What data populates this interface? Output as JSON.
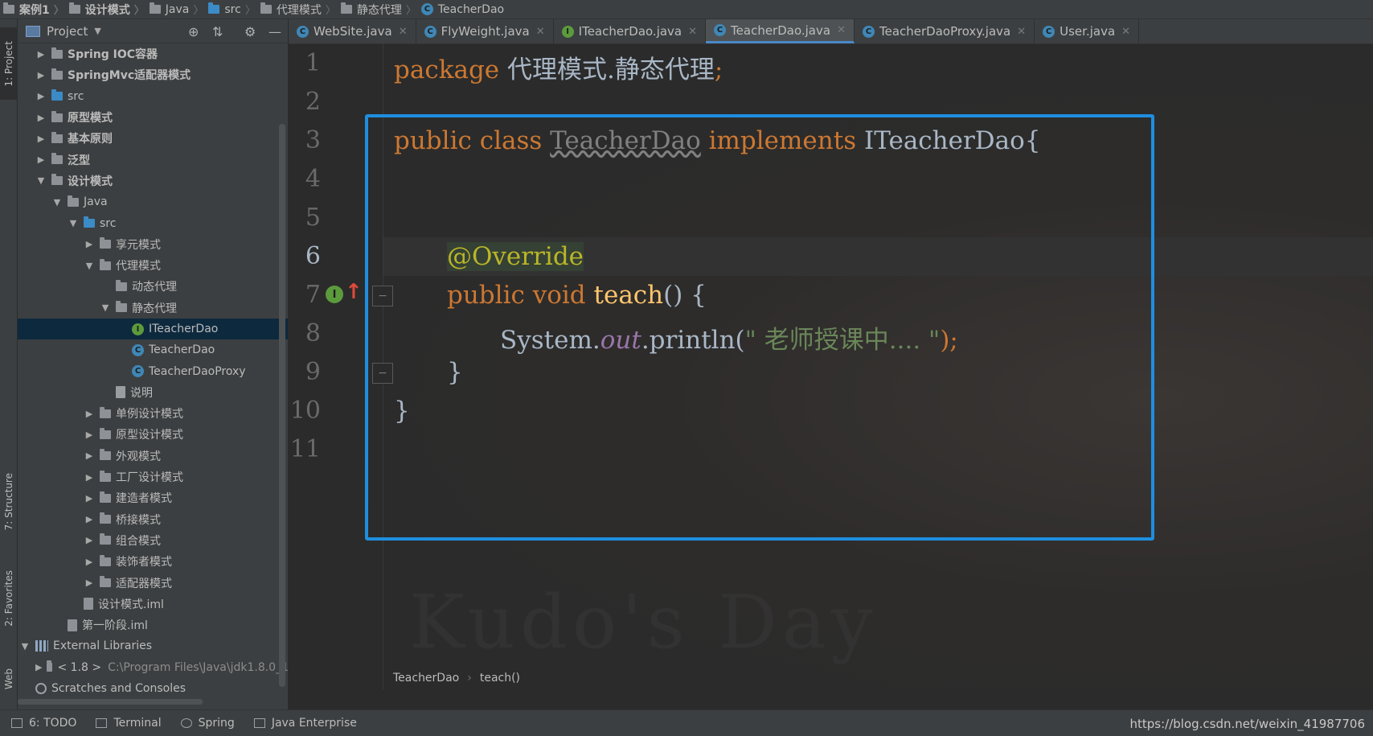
{
  "breadcrumb": [
    "案例1",
    "设计模式",
    "Java",
    "src",
    "代理模式",
    "静态代理",
    "TeacherDao"
  ],
  "side_tabs": {
    "project": "1: Project",
    "structure": "7: Structure",
    "favorites": "2: Favorites",
    "web": "Web"
  },
  "project_panel": {
    "title": "Project"
  },
  "tree": [
    {
      "label": "Spring IOC容器",
      "icon": "module-folder",
      "expand": "collapsed",
      "bold": true
    },
    {
      "label": "SpringMvc适配器模式",
      "icon": "module-folder",
      "expand": "collapsed",
      "bold": true
    },
    {
      "label": "src",
      "icon": "source-folder",
      "expand": "collapsed",
      "bold": false
    },
    {
      "label": "原型模式",
      "icon": "module-folder",
      "expand": "collapsed",
      "bold": true
    },
    {
      "label": "基本原则",
      "icon": "module-folder",
      "expand": "collapsed",
      "bold": true
    },
    {
      "label": "泛型",
      "icon": "module-folder",
      "expand": "collapsed",
      "bold": true
    },
    {
      "label": "设计模式",
      "icon": "module-folder",
      "expand": "expanded",
      "bold": true
    },
    {
      "label": "Java",
      "icon": "folder",
      "expand": "expanded",
      "bold": false
    },
    {
      "label": "src",
      "icon": "source-folder",
      "expand": "expanded",
      "bold": false
    },
    {
      "label": "享元模式",
      "icon": "package",
      "expand": "collapsed",
      "bold": false
    },
    {
      "label": "代理模式",
      "icon": "package",
      "expand": "expanded",
      "bold": false
    },
    {
      "label": "动态代理",
      "icon": "package",
      "expand": "none",
      "bold": false
    },
    {
      "label": "静态代理",
      "icon": "package",
      "expand": "expanded",
      "bold": false
    },
    {
      "label": "ITeacherDao",
      "icon": "interface",
      "expand": "none",
      "bold": false,
      "selected": true
    },
    {
      "label": "TeacherDao",
      "icon": "class",
      "expand": "none",
      "bold": false
    },
    {
      "label": "TeacherDaoProxy",
      "icon": "class",
      "expand": "none",
      "bold": false
    },
    {
      "label": "说明",
      "icon": "text-file",
      "expand": "none",
      "bold": false
    },
    {
      "label": "单例设计模式",
      "icon": "package",
      "expand": "collapsed",
      "bold": false
    },
    {
      "label": "原型设计模式",
      "icon": "package",
      "expand": "collapsed",
      "bold": false
    },
    {
      "label": "外观模式",
      "icon": "package",
      "expand": "collapsed",
      "bold": false
    },
    {
      "label": "工厂设计模式",
      "icon": "package",
      "expand": "collapsed",
      "bold": false
    },
    {
      "label": "建造者模式",
      "icon": "package",
      "expand": "collapsed",
      "bold": false
    },
    {
      "label": "桥接模式",
      "icon": "package",
      "expand": "collapsed",
      "bold": false
    },
    {
      "label": "组合模式",
      "icon": "package",
      "expand": "collapsed",
      "bold": false
    },
    {
      "label": "装饰者模式",
      "icon": "package",
      "expand": "collapsed",
      "bold": false
    },
    {
      "label": "适配器模式",
      "icon": "package",
      "expand": "collapsed",
      "bold": false
    },
    {
      "label": "设计模式.iml",
      "icon": "iml-file",
      "expand": "none",
      "bold": false
    },
    {
      "label": "第一阶段.iml",
      "icon": "iml-file",
      "expand": "none",
      "bold": false
    },
    {
      "label": "External Libraries",
      "icon": "library",
      "expand": "expanded",
      "bold": false
    },
    {
      "label": "< 1.8 >",
      "icon": "jdk",
      "expand": "collapsed",
      "bold": false,
      "path": "C:\\Program Files\\Java\\jdk1.8.0_1"
    },
    {
      "label": "Scratches and Consoles",
      "icon": "scratches",
      "expand": "none",
      "bold": false
    }
  ],
  "tabs": [
    {
      "label": "WebSite.java",
      "icon": "class"
    },
    {
      "label": "FlyWeight.java",
      "icon": "class"
    },
    {
      "label": "ITeacherDao.java",
      "icon": "interface"
    },
    {
      "label": "TeacherDao.java",
      "icon": "class",
      "active": true
    },
    {
      "label": "TeacherDaoProxy.java",
      "icon": "class"
    },
    {
      "label": "User.java",
      "icon": "class"
    }
  ],
  "editor": {
    "line_numbers": [
      "1",
      "2",
      "3",
      "4",
      "5",
      "6",
      "7",
      "8",
      "9",
      "10",
      "11"
    ],
    "current_line": "6",
    "code": {
      "l1_kw": "package",
      "l1_rest": "代理模式.静态代理",
      "l1_semi": ";",
      "l3_kw1": "public",
      "l3_kw2": "class",
      "l3_name": "TeacherDao",
      "l3_kw3": "implements",
      "l3_iface": "ITeacherDao{",
      "l6_ann": "@Override",
      "l7_kw1": "public",
      "l7_kw2": "void",
      "l7_method": "teach",
      "l7_rest": "() {",
      "l8_sys": "System.",
      "l8_out": "out",
      "l8_println": ".println(",
      "l8_str": "\" 老师授课中.... \"",
      "l8_end": ");",
      "l9": "}",
      "l10": "}"
    },
    "watermark": "Kudo's Day",
    "crumbs": [
      "TeacherDao",
      "teach()"
    ],
    "highlight_color": "#1e8ee0"
  },
  "statusbar": {
    "items": [
      "6: TODO",
      "Terminal",
      "Spring",
      "Java Enterprise"
    ],
    "url": "https://blog.csdn.net/weixin_41987706"
  }
}
